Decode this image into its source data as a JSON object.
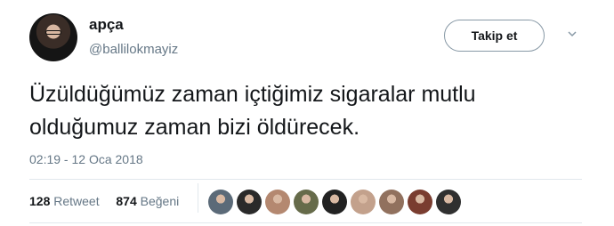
{
  "user": {
    "name": "apça",
    "handle": "@ballilokmayiz"
  },
  "follow_button": {
    "label": "Takip et"
  },
  "tweet": {
    "lines": [
      "Üzüldüğümüz zaman içtiğimiz sigaralar mutlu",
      "olduğumuz zaman bizi öldürecek."
    ],
    "timestamp": "02:19 - 12 Oca 2018"
  },
  "stats": {
    "retweets": "128",
    "retweet_label": "Retweet",
    "likes": "874",
    "like_label": "Beğeni"
  },
  "likers": [
    {
      "name": "liker-avatar-1",
      "color": "#5b6a78"
    },
    {
      "name": "liker-avatar-2",
      "color": "#2a2a2a"
    },
    {
      "name": "liker-avatar-3",
      "color": "#b48870"
    },
    {
      "name": "liker-avatar-4",
      "color": "#666b4a"
    },
    {
      "name": "liker-avatar-5",
      "color": "#222222"
    },
    {
      "name": "liker-avatar-6",
      "color": "#c3a18c"
    },
    {
      "name": "liker-avatar-7",
      "color": "#91715e"
    },
    {
      "name": "liker-avatar-8",
      "color": "#7a3d30"
    },
    {
      "name": "liker-avatar-9",
      "color": "#303030"
    }
  ],
  "icons": {
    "more": "chevron-down-icon"
  }
}
